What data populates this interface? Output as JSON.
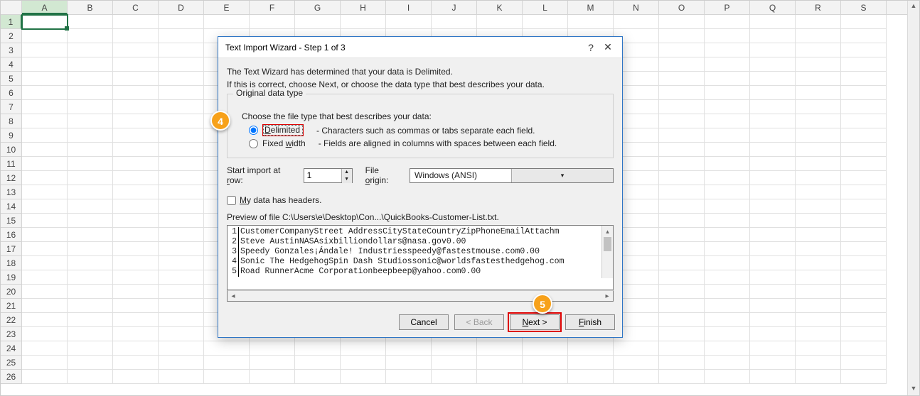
{
  "columns": [
    "A",
    "B",
    "C",
    "D",
    "E",
    "F",
    "G",
    "H",
    "I",
    "J",
    "K",
    "L",
    "M",
    "N",
    "O",
    "P",
    "Q",
    "R",
    "S"
  ],
  "row_count": 26,
  "active_col": "A",
  "active_row": 1,
  "dialog": {
    "title": "Text Import Wizard - Step 1 of 3",
    "help_symbol": "?",
    "close_symbol": "✕",
    "intro1": "The Text Wizard has determined that your data is Delimited.",
    "intro2": "If this is correct, choose Next, or choose the data type that best describes your data.",
    "group_legend": "Original data type",
    "group_prompt": "Choose the file type that best describes your data:",
    "radio_delimited_label": "Delimited",
    "radio_delimited_desc": "- Characters such as commas or tabs separate each field.",
    "radio_fixed_label": "Fixed width",
    "radio_fixed_desc": "- Fields are aligned in columns with spaces between each field.",
    "start_row_label": "Start import at row:",
    "start_row_value": "1",
    "file_origin_label": "File origin:",
    "file_origin_value": "Windows (ANSI)",
    "headers_label": "My data has headers.",
    "preview_label": "Preview of file C:\\Users\\e\\Desktop\\Con...\\QuickBooks-Customer-List.txt.",
    "preview_lines": [
      {
        "n": "1",
        "t": "CustomerCompanyStreet AddressCityStateCountryZipPhoneEmailAttachm"
      },
      {
        "n": "2",
        "t": "Steve AustinNASAsixbilliondollars@nasa.gov0.00"
      },
      {
        "n": "3",
        "t": "Speedy Gonzales¡Ándale! Industriesspeedy@fastestmouse.com0.00"
      },
      {
        "n": "4",
        "t": "Sonic The HedgehogSpin Dash Studiossonic@worldsfastesthedgehog.com"
      },
      {
        "n": "5",
        "t": "Road RunnerAcme Corporationbeepbeep@yahoo.com0.00"
      }
    ],
    "btn_cancel": "Cancel",
    "btn_back": "< Back",
    "btn_next": "Next >",
    "btn_finish": "Finish"
  },
  "annotations": {
    "badge4": "4",
    "badge5": "5"
  }
}
